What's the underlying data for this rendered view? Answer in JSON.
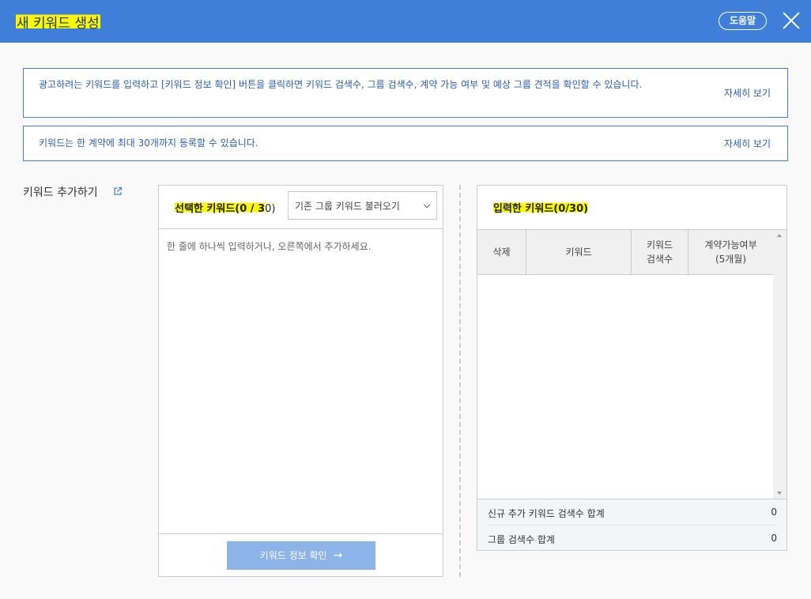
{
  "header": {
    "title": "새 키워드 생성",
    "help_label": "도움말"
  },
  "notices": [
    {
      "text": "광고하려는 키워드를 입력하고 [키워드 정보 확인] 버튼을 클릭하면 키워드 검색수, 그룹 검색수, 계약 가능 여부 및 예상 그룹 견적을 확인할 수 있습니다.",
      "more": "자세히 보기"
    },
    {
      "text": "키워드는 한 계약에 최대 30개까지 등록할 수 있습니다.",
      "more": "자세히 보기"
    }
  ],
  "side": {
    "label": "키워드 추가하기"
  },
  "left_panel": {
    "title_highlight": "선택한 키워드(0 / 3",
    "title_tail": "0)",
    "select_value": "기존 그룹 키워드 불러오기",
    "textarea_placeholder": "한 줄에 하나씩 입력하거나, 오른쪽에서 추가하세요.",
    "confirm_label": "키워드 정보 확인",
    "confirm_arrow": "→"
  },
  "right_panel": {
    "title": "입력한 키워드(0/30)",
    "columns": [
      "삭제",
      "키워드",
      "키워드\n검색수",
      "계약가능여부\n(5개월)"
    ],
    "rows": [],
    "summary": [
      {
        "label": "신규 추가 키워드 검색수 합계",
        "value": "0"
      },
      {
        "label": "그룹 검색수 합계",
        "value": "0"
      }
    ]
  },
  "colors": {
    "header_bg": "#3f7fd9",
    "accent": "#2a5fb0",
    "highlight": "#f2ff00",
    "button_disabled": "#8db4e8"
  },
  "icons": {
    "close": "close-icon",
    "external": "external-link-icon",
    "dropdown": "chevron-down-icon",
    "arrow": "arrow-right-icon"
  }
}
